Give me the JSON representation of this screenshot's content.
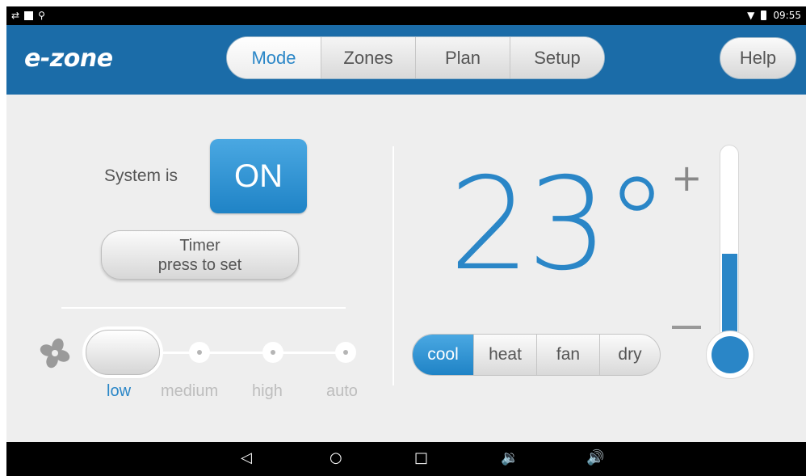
{
  "status_bar": {
    "time": "09:55",
    "icons": [
      "signal-arrows-icon",
      "square-notification-icon",
      "usb-icon",
      "wifi-icon",
      "battery-icon"
    ]
  },
  "app": {
    "logo": "e-zone",
    "tabs": [
      {
        "label": "Mode",
        "active": true
      },
      {
        "label": "Zones",
        "active": false
      },
      {
        "label": "Plan",
        "active": false
      },
      {
        "label": "Setup",
        "active": false
      }
    ],
    "help_label": "Help",
    "brand_color": "#1b6ca8",
    "accent_color": "#2a86c7"
  },
  "system": {
    "label": "System is",
    "state": "ON"
  },
  "timer": {
    "line1": "Timer",
    "line2": "press to set"
  },
  "fan_speed": {
    "icon": "fan-icon",
    "options": [
      "low",
      "medium",
      "high",
      "auto"
    ],
    "selected": "low"
  },
  "temperature": {
    "value": "23°",
    "increase_symbol": "+",
    "slider_level_fraction": 0.5
  },
  "modes": {
    "options": [
      "cool",
      "heat",
      "fan",
      "dry"
    ],
    "selected": "cool"
  },
  "nav_bar": {
    "icons": [
      "back-icon",
      "home-icon",
      "recents-icon",
      "volume-down-icon",
      "volume-up-icon"
    ],
    "glyphs": [
      "◁",
      "○",
      "□",
      "🔉",
      "🔊"
    ]
  }
}
